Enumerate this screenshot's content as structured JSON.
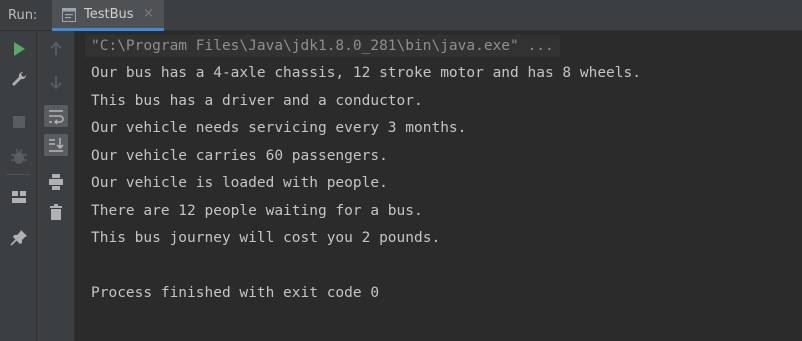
{
  "header": {
    "run_label": "Run:",
    "tab": {
      "label": "TestBus",
      "close_glyph": "×",
      "icon": "console-tab-icon"
    }
  },
  "toolbar": {
    "primary": [
      {
        "name": "rerun-icon",
        "color": "#59a869"
      },
      {
        "name": "wrench-icon",
        "color": "#afb1b3"
      },
      {
        "name": "stop-icon",
        "color": "#5a5d5f"
      },
      {
        "name": "debug-bug-icon",
        "color": "#5a5d5f"
      },
      {
        "name": "layout-icon",
        "color": "#afb1b3"
      },
      {
        "name": "pin-icon",
        "color": "#afb1b3"
      }
    ],
    "secondary": [
      {
        "name": "up-arrow-icon"
      },
      {
        "name": "down-arrow-icon"
      },
      {
        "name": "soft-wrap-icon",
        "active": true
      },
      {
        "name": "scroll-to-end-icon",
        "active": true
      },
      {
        "name": "print-icon"
      },
      {
        "name": "trash-icon"
      }
    ]
  },
  "console": {
    "command": "\"C:\\Program Files\\Java\\jdk1.8.0_281\\bin\\java.exe\" ...",
    "lines": [
      "Our bus has a 4-axle chassis, 12 stroke motor and has 8 wheels.",
      "This bus has a driver and a conductor.",
      "Our vehicle needs servicing every 3 months.",
      "Our vehicle carries 60 passengers.",
      "Our vehicle is loaded with people.",
      "There are 12 people waiting for a bus.",
      "This bus journey will cost you 2 pounds.",
      "",
      "Process finished with exit code 0"
    ]
  }
}
